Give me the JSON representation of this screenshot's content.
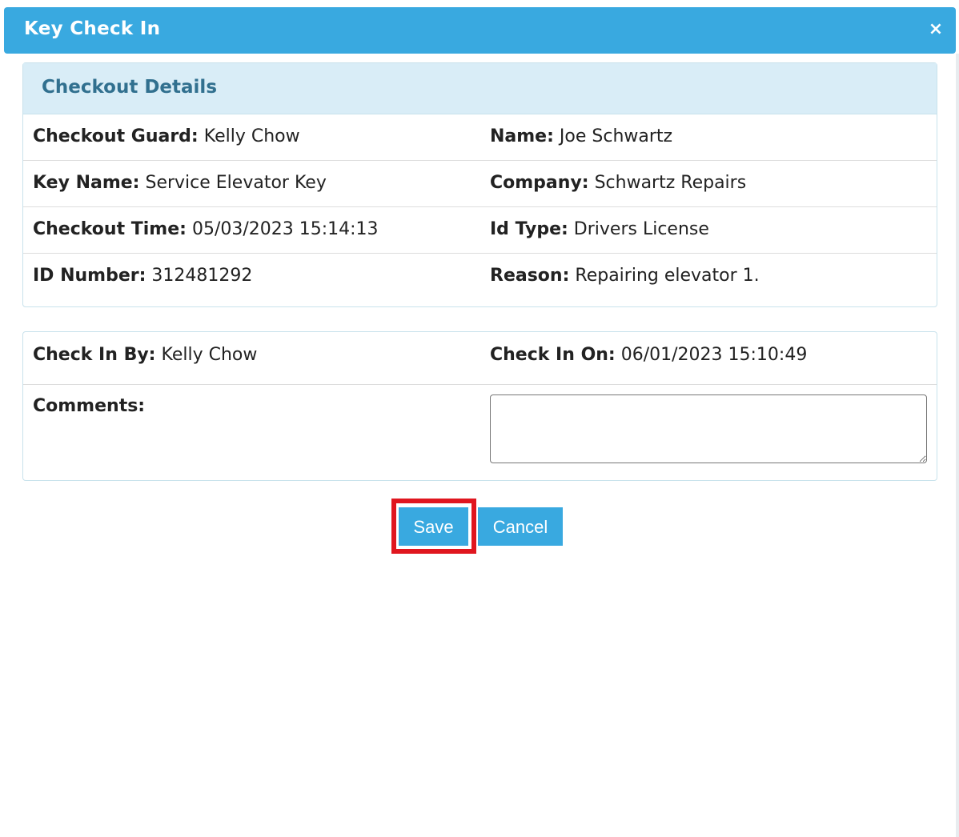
{
  "modal": {
    "title": "Key Check In",
    "close_symbol": "×"
  },
  "checkout_details": {
    "heading": "Checkout Details",
    "fields": {
      "checkout_guard": {
        "label": "Checkout Guard:",
        "value": " Kelly Chow"
      },
      "name": {
        "label": "Name:",
        "value": "Joe Schwartz"
      },
      "key_name": {
        "label": "Key Name:",
        "value": "Service Elevator Key"
      },
      "company": {
        "label": "Company:",
        "value": "Schwartz Repairs"
      },
      "checkout_time": {
        "label": "Checkout Time:",
        "value": "05/03/2023 15:14:13"
      },
      "id_type": {
        "label": "Id Type:",
        "value": "Drivers License"
      },
      "id_number": {
        "label": "ID Number:",
        "value": "312481292"
      },
      "reason": {
        "label": "Reason:",
        "value": "Repairing elevator 1."
      }
    }
  },
  "check_in": {
    "check_in_by": {
      "label": "Check In By:",
      "value": "Kelly Chow"
    },
    "check_in_on": {
      "label": "Check In On:",
      "value": "06/01/2023 15:10:49"
    },
    "comments": {
      "label": "Comments:",
      "value": ""
    }
  },
  "buttons": {
    "save_label": "Save",
    "cancel_label": "Cancel"
  },
  "colors": {
    "header_bg": "#39a9e0",
    "panel_heading_bg": "#d9edf7",
    "panel_heading_text": "#31708f",
    "highlight": "#e0161f"
  }
}
